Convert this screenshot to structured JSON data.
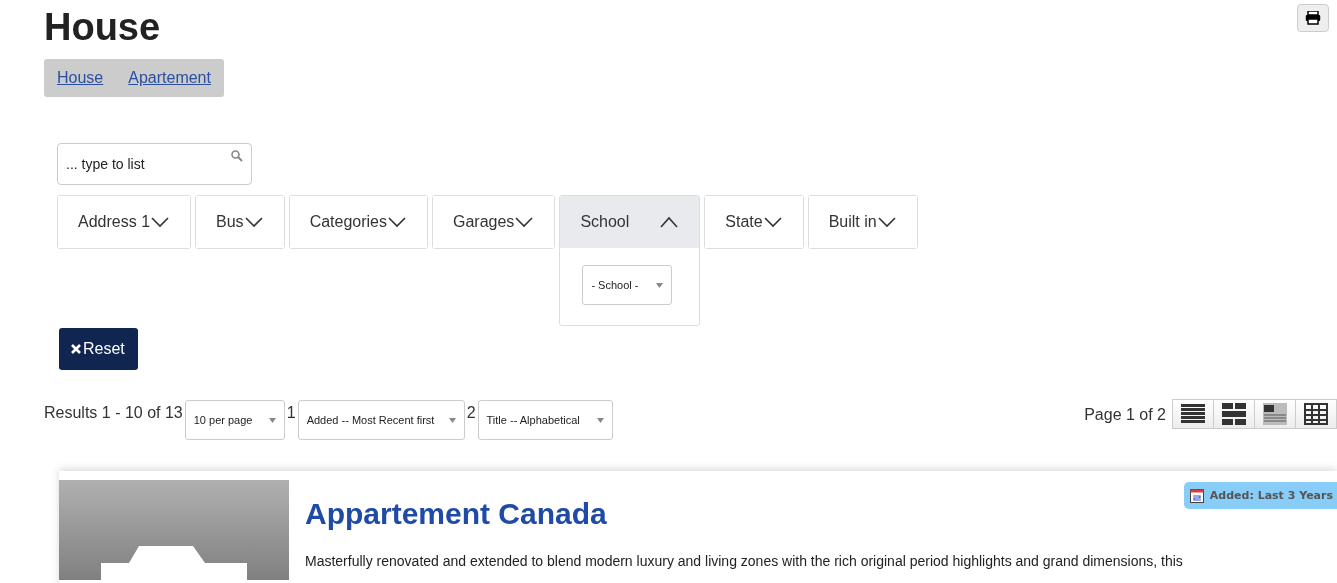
{
  "title": "House",
  "type_links": [
    {
      "label": "House"
    },
    {
      "label": "Apartement"
    }
  ],
  "search": {
    "placeholder": "... type to list"
  },
  "filters": [
    {
      "label": "Address 1",
      "expanded": false
    },
    {
      "label": "Bus",
      "expanded": false
    },
    {
      "label": "Categories",
      "expanded": false
    },
    {
      "label": "Garages",
      "expanded": false
    },
    {
      "label": "School",
      "expanded": true,
      "select": "- School -"
    },
    {
      "label": "State",
      "expanded": false
    },
    {
      "label": "Built in",
      "expanded": false
    }
  ],
  "reset_button": "Reset",
  "results": {
    "summary": "Results 1 - 10 of 13",
    "per_page": "10 per page",
    "sort_1_label": "1",
    "sort_1": "Added -- Most Recent first",
    "sort_2_label": "2",
    "sort_2": "Title -- Alphabetical",
    "page": "Page 1 of 2"
  },
  "view_modes": [
    {
      "kind": "list"
    },
    {
      "kind": "blocks"
    },
    {
      "kind": "article"
    },
    {
      "kind": "table"
    }
  ],
  "listing": {
    "kind": "picture",
    "title": "Appartement Canada",
    "badge": "Added: Last 3 Years",
    "description": "Masterfully renovated and extended to blend modern luxury and living zones with the rich original period highlights and grand dimensions, this"
  }
}
